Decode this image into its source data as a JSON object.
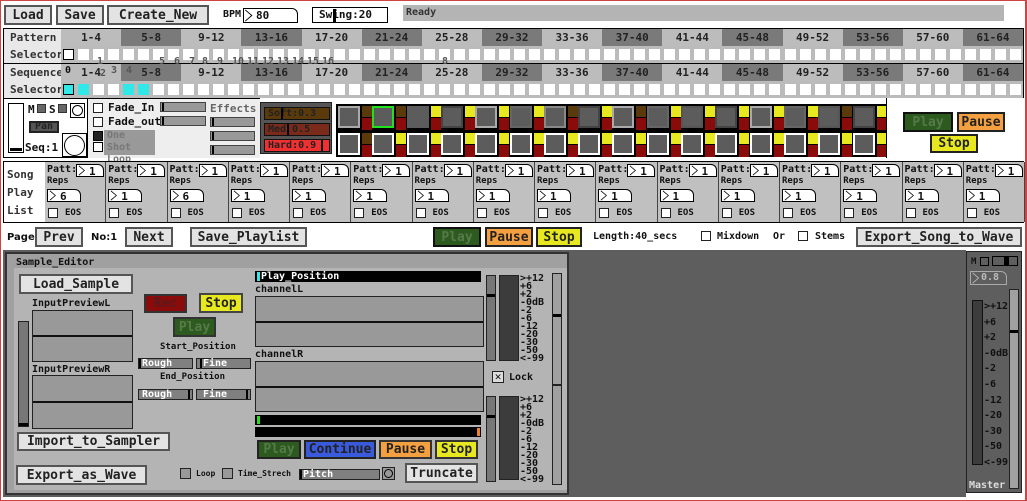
{
  "toolbar": {
    "load": "Load",
    "save": "Save",
    "create_new": "Create_New",
    "bpm_label": "BPM",
    "bpm_value": "80",
    "swing_value": "Swing:20",
    "status": "Ready"
  },
  "pattern_selector": {
    "label1": "Pattern",
    "label2": "Selector",
    "ranges": [
      "1-4",
      "5-8",
      "9-12",
      "13-16",
      "17-20",
      "21-24",
      "25-28",
      "29-32",
      "33-36",
      "37-40",
      "41-44",
      "45-48",
      "49-52",
      "53-56",
      "57-60",
      "61-64"
    ]
  },
  "sequence_selector": {
    "label1": "Sequence",
    "label2": "Selector",
    "ranges": [
      "1-4",
      "5-8",
      "9-12",
      "13-16",
      "17-20",
      "21-24",
      "25-28",
      "29-32",
      "33-36",
      "37-40",
      "41-44",
      "45-48",
      "49-52",
      "53-56",
      "57-60",
      "61-64"
    ],
    "active_cells": [
      0,
      1,
      4,
      5
    ],
    "overlay_numbers": [
      "0",
      "1",
      "2",
      "3",
      "4",
      "5",
      "6",
      "7",
      "8",
      "9",
      "10",
      "11",
      "12",
      "13",
      "14",
      "15",
      "16",
      "8"
    ]
  },
  "channel": {
    "m": "M",
    "s": "S",
    "pan": "Pan",
    "seq": "Seq:1",
    "fade_in": "Fade_In",
    "fade_out": "Fade_out",
    "one_shot": "One Shot",
    "loop": "Loop",
    "effects": "Effects",
    "soft": "Soft:0.3",
    "med": "Med 0.5",
    "hard": "Hard:0.9"
  },
  "transport_top": {
    "play": "Play",
    "pause": "Pause",
    "stop": "Stop"
  },
  "song_playlist": {
    "label": [
      "Song",
      "Play",
      "List"
    ],
    "patt_label": "Patt:",
    "reps_label": "Reps",
    "eos_label": "EOS",
    "slots": [
      {
        "patt": "1",
        "reps": "6"
      },
      {
        "patt": "1",
        "reps": "1"
      },
      {
        "patt": "1",
        "reps": "6"
      },
      {
        "patt": "1",
        "reps": "1"
      },
      {
        "patt": "1",
        "reps": "1"
      },
      {
        "patt": "1",
        "reps": "1"
      },
      {
        "patt": "1",
        "reps": "1"
      },
      {
        "patt": "1",
        "reps": "1"
      },
      {
        "patt": "1",
        "reps": "1"
      },
      {
        "patt": "1",
        "reps": "1"
      },
      {
        "patt": "1",
        "reps": "1"
      },
      {
        "patt": "1",
        "reps": "1"
      },
      {
        "patt": "1",
        "reps": "1"
      },
      {
        "patt": "1",
        "reps": "1"
      },
      {
        "patt": "1",
        "reps": "1"
      },
      {
        "patt": "1",
        "reps": "1"
      }
    ]
  },
  "page_bar": {
    "page": "Page",
    "prev": "Prev",
    "no": "No:1",
    "next": "Next",
    "save_playlist": "Save_Playlist",
    "play": "Play",
    "pause": "Pause",
    "stop": "Stop",
    "length": "Length:40_secs",
    "mixdown": "Mixdown",
    "or": "Or",
    "stems": "Stems",
    "export_song": "Export_Song_to_Wave"
  },
  "sample_editor": {
    "title": "Sample_Editor",
    "load_sample": "Load_Sample",
    "input_preview_l": "InputPreviewL",
    "input_preview_r": "InputPreviewR",
    "rec": "Rec",
    "stop": "Stop",
    "play": "Play",
    "start_position": "Start_Position",
    "end_position": "End_Position",
    "rough": "Rough",
    "fine": "Fine",
    "play_position": "Play_Position",
    "channel_l": "channelL",
    "channel_r": "channelR",
    "play2": "Play",
    "continue": "Continue",
    "pause": "Pause",
    "stop2": "Stop",
    "import_sampler": "Import_to_Sampler",
    "export_wave": "Export_as_Wave",
    "loop": "Loop",
    "time_stretch": "Time_Strech",
    "pitch": "Pitch",
    "truncate": "Truncate",
    "lock": "Lock",
    "db_scale": [
      ">+12",
      "+6",
      "+2",
      "-0dB",
      "-2",
      "-6",
      "-12",
      "-20",
      "-30",
      "-50",
      "<-99"
    ]
  },
  "master": {
    "m": "M",
    "value": "0.8",
    "label": "Master",
    "db_scale": [
      ">+12",
      "+6",
      "+2",
      "-0dB",
      "-2",
      "-6",
      "-12",
      "-20",
      "-30",
      "-50",
      "<-99"
    ]
  },
  "colors": {
    "play_bg": "#2d5a1e",
    "pause_bg": "#f5a040",
    "stop_bg": "#e8e820",
    "continue_bg": "#3a5adc",
    "rec_bg": "#8b0a0a",
    "soft_bg": "#5a3a0a",
    "med_bg": "#7a2a1a",
    "hard_bg": "#f03030",
    "cyan": "#30e8e8"
  }
}
